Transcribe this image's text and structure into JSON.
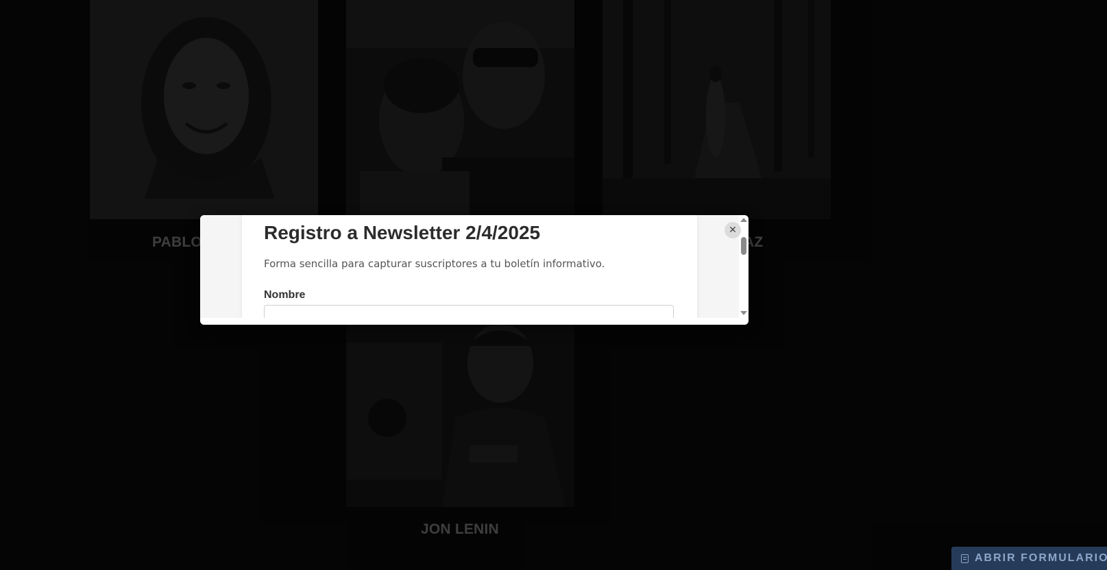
{
  "cards": [
    {
      "name": "PABLO",
      "photo": "portrait-sketch"
    },
    {
      "name": "",
      "photo": "couple-selfie"
    },
    {
      "name": "AZ",
      "photo": "forest-path"
    },
    {
      "name": "JON LENIN",
      "photo": "filmmaker-portrait"
    }
  ],
  "modal": {
    "title": "Registro a Newsletter 2/4/2025",
    "description": "Forma sencilla para capturar suscriptores a tu boletín informativo.",
    "fields": [
      {
        "label": "Nombre",
        "value": "",
        "placeholder": ""
      }
    ],
    "close_icon": "close-icon"
  },
  "floating_button": {
    "label": "ABRIR FORMULARIO",
    "icon": "document-icon",
    "color": "#263b5a"
  },
  "colors": {
    "background": "#0b0b0b",
    "card_name": "#8a8a8a",
    "modal_background": "#ffffff"
  }
}
